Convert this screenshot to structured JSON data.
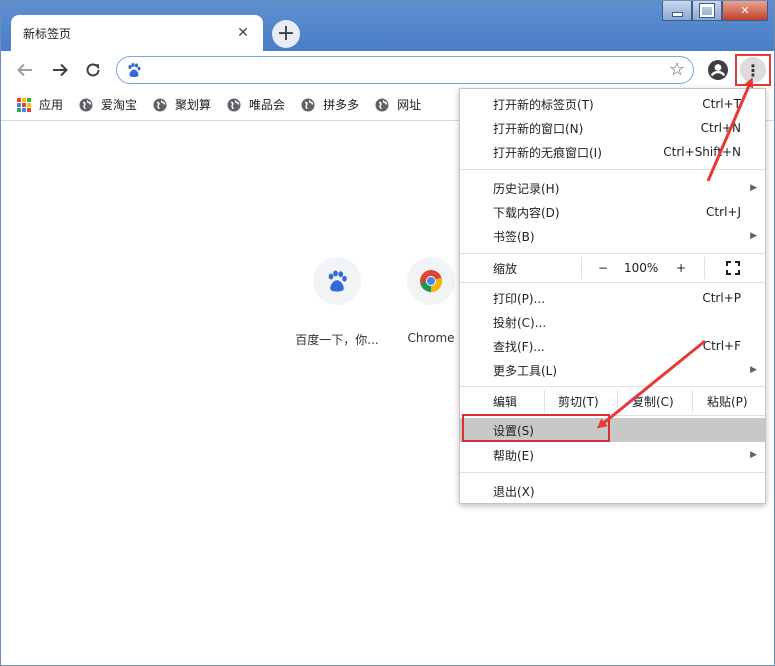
{
  "window": {
    "tab_title": "新标签页"
  },
  "toolbar": {
    "omnibox_value": ""
  },
  "bookmarks": [
    {
      "label": "应用",
      "icon": "apps-grid-icon"
    },
    {
      "label": "爱淘宝",
      "icon": "globe-icon"
    },
    {
      "label": "聚划算",
      "icon": "globe-icon"
    },
    {
      "label": "唯品会",
      "icon": "globe-icon"
    },
    {
      "label": "拼多多",
      "icon": "globe-icon"
    },
    {
      "label": "网址",
      "icon": "globe-icon"
    }
  ],
  "shortcuts": [
    {
      "label": "百度一下，你...",
      "icon": "baidu-paw-icon"
    },
    {
      "label": "Chrome",
      "icon": "chrome-icon"
    }
  ],
  "menu": {
    "new_tab": {
      "label": "打开新的标签页(T)",
      "shortcut": "Ctrl+T"
    },
    "new_window": {
      "label": "打开新的窗口(N)",
      "shortcut": "Ctrl+N"
    },
    "incognito": {
      "label": "打开新的无痕窗口(I)",
      "shortcut": "Ctrl+Shift+N"
    },
    "history": {
      "label": "历史记录(H)"
    },
    "downloads": {
      "label": "下载内容(D)",
      "shortcut": "Ctrl+J"
    },
    "bookmarks": {
      "label": "书签(B)"
    },
    "zoom": {
      "label": "缩放",
      "minus": "−",
      "value": "100%",
      "plus": "+"
    },
    "print": {
      "label": "打印(P)...",
      "shortcut": "Ctrl+P"
    },
    "cast": {
      "label": "投射(C)..."
    },
    "find": {
      "label": "查找(F)...",
      "shortcut": "Ctrl+F"
    },
    "more_tools": {
      "label": "更多工具(L)"
    },
    "edit": {
      "label": "编辑",
      "cut": "剪切(T)",
      "copy": "复制(C)",
      "paste": "粘贴(P)"
    },
    "settings": {
      "label": "设置(S)"
    },
    "help": {
      "label": "帮助(E)"
    },
    "exit": {
      "label": "退出(X)"
    }
  },
  "colors": {
    "annotation": "#e53935",
    "titlebar": "#5f8fd0",
    "menu_hover": "#c8c8c8"
  }
}
